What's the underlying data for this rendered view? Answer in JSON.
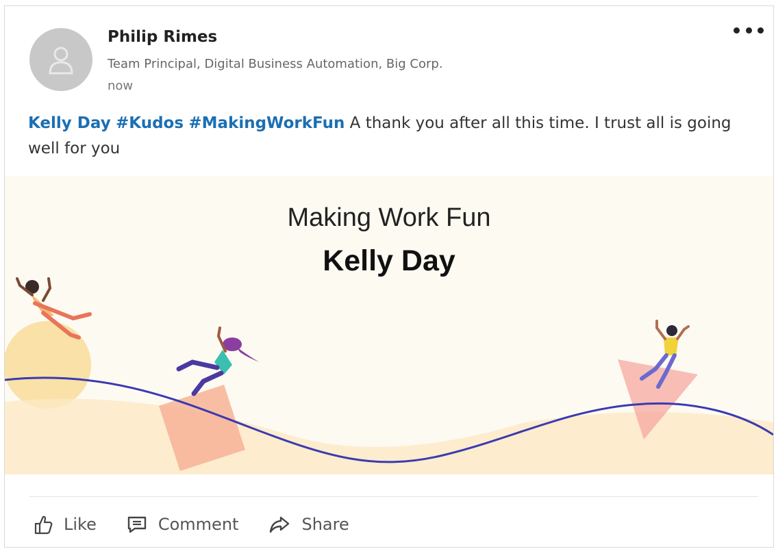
{
  "post": {
    "author": "Philip Rimes",
    "role": "Team Principal, Digital Business Automation, Big Corp.",
    "time": "now",
    "mention": "Kelly Day",
    "hashtag1": "#Kudos",
    "hashtag2": "#MakingWorkFun",
    "text": "A thank you after all this time. I trust all is going well for you"
  },
  "banner": {
    "subtitle": "Making Work Fun",
    "title": "Kelly Day"
  },
  "actions": {
    "like": "Like",
    "comment": "Comment",
    "share": "Share"
  },
  "icons": {
    "avatar": "person-icon",
    "more": "more-icon",
    "like": "thumbs-up-icon",
    "comment": "comment-icon",
    "share": "share-arrow-icon"
  },
  "colors": {
    "link": "#1b6fb3",
    "wave": "#3a3ab0",
    "banner_bg": "#fdfaf2"
  }
}
